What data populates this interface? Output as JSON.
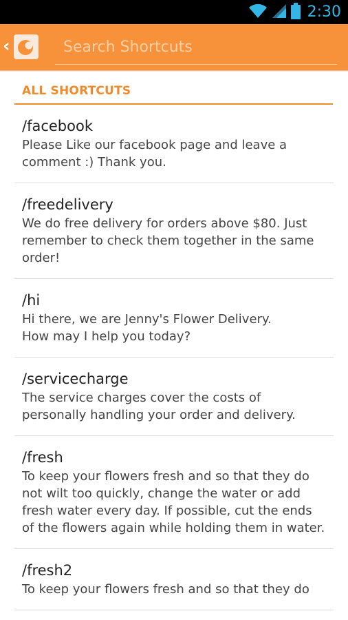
{
  "status_bar": {
    "time": "2:30",
    "icons": [
      "wifi-icon",
      "signal-icon",
      "battery-icon"
    ],
    "accent_color": "#33b5e5"
  },
  "action_bar": {
    "color": "#f7913a",
    "search_placeholder": "Search Shortcuts",
    "search_value": ""
  },
  "section": {
    "title": "ALL SHORTCUTS"
  },
  "shortcuts": [
    {
      "name": "/facebook",
      "text": "Please Like our facebook page and leave a comment :) Thank you."
    },
    {
      "name": "/freedelivery",
      "text": "We do free delivery for orders above $80. Just remember to check them together in the same order!"
    },
    {
      "name": "/hi",
      "text": "Hi there, we are Jenny's Flower Delivery.\nHow may I help you today?"
    },
    {
      "name": "/servicecharge",
      "text": "The service charges cover the costs of personally handling your order and delivery."
    },
    {
      "name": "/fresh",
      "text": "To keep your flowers fresh and so that they do not wilt too quickly, change the water or add fresh water every day. If possible, cut the ends of the flowers again while holding them in water."
    },
    {
      "name": "/fresh2",
      "text": "To keep your flowers fresh and so that they do"
    }
  ]
}
